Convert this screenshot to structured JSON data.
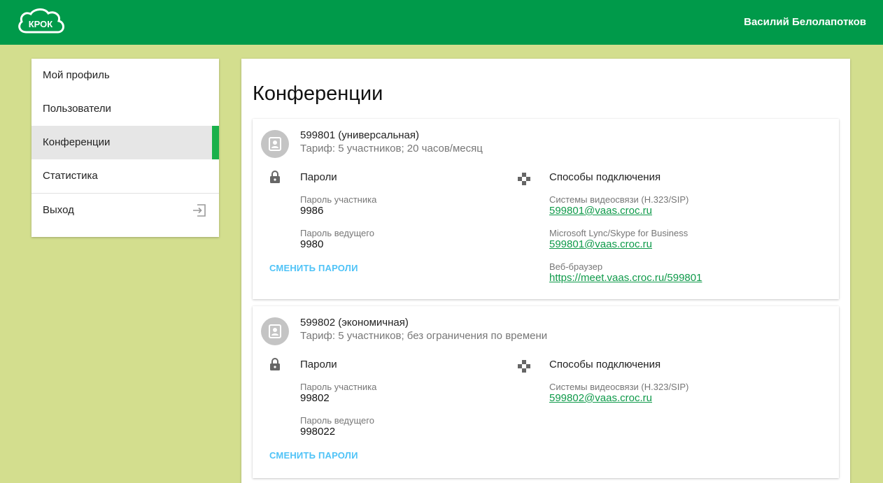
{
  "header": {
    "logo_text": "КРОК",
    "user_name": "Василий Белолапотков"
  },
  "sidebar": {
    "items": [
      {
        "label": "Мой профиль"
      },
      {
        "label": "Пользователи"
      },
      {
        "label": "Конференции"
      },
      {
        "label": "Статистика"
      },
      {
        "label": "Выход"
      }
    ]
  },
  "main": {
    "title": "Конференции",
    "conferences": [
      {
        "name": "599801 (универсальная)",
        "tariff": "Тариф: 5 участников; 20 часов/месяц",
        "passwords_title": "Пароли",
        "participant_label": "Пароль участника",
        "participant_value": "9986",
        "host_label": "Пароль ведущего",
        "host_value": "9980",
        "change_label": "СМЕНИТЬ ПАРОЛИ",
        "connect_title": "Способы подключения",
        "methods": [
          {
            "label": "Системы видеосвязи (H.323/SIP)",
            "link": "599801@vaas.croc.ru"
          },
          {
            "label": "Microsoft Lync/Skype for Business",
            "link": "599801@vaas.croc.ru"
          },
          {
            "label": "Веб-браузер",
            "link": "https://meet.vaas.croc.ru/599801"
          }
        ]
      },
      {
        "name": "599802 (экономичная)",
        "tariff": "Тариф: 5 участников; без ограничения по времени",
        "passwords_title": "Пароли",
        "participant_label": "Пароль участника",
        "participant_value": "99802",
        "host_label": "Пароль ведущего",
        "host_value": "998022",
        "change_label": "СМЕНИТЬ ПАРОЛИ",
        "connect_title": "Способы подключения",
        "methods": [
          {
            "label": "Системы видеосвязи (H.323/SIP)",
            "link": "599802@vaas.croc.ru"
          }
        ]
      }
    ]
  }
}
